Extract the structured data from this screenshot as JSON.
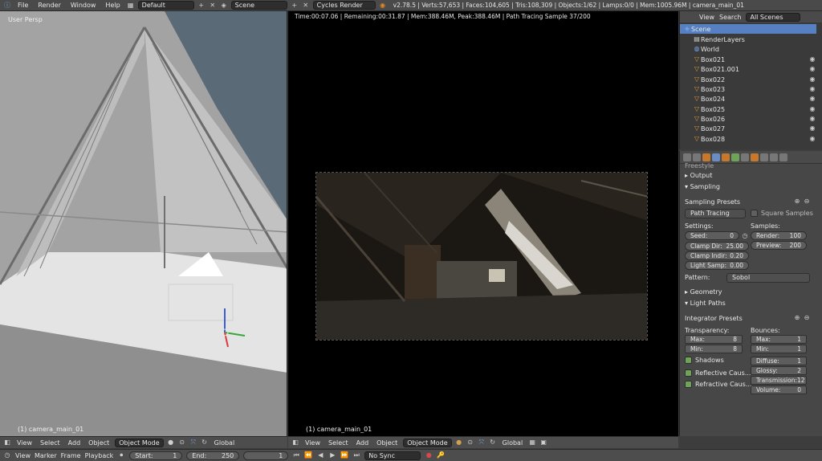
{
  "topbar": {
    "menus": [
      "File",
      "Render",
      "Window",
      "Help"
    ],
    "layout": "Default",
    "scene": "Scene",
    "engine": "Cycles Render",
    "stats": "v2.78.5 | Verts:57,653 | Faces:104,605 | Tris:108,309 | Objects:1/62 | Lamps:0/0 | Mem:1005.96M | camera_main_01"
  },
  "left_view": {
    "label": "User Persp",
    "object_label": "(1) camera_main_01",
    "header": {
      "view": "View",
      "select": "Select",
      "add": "Add",
      "object": "Object",
      "mode": "Object Mode",
      "orient": "Global"
    }
  },
  "render_view": {
    "status": "Time:00:07.06 | Remaining:00:31.87 | Mem:388.46M, Peak:388.46M | Path Tracing Sample 37/200",
    "object_label": "(1) camera_main_01",
    "header": {
      "view": "View",
      "select": "Select",
      "add": "Add",
      "object": "Object",
      "mode": "Object Mode",
      "orient": "Global"
    }
  },
  "outliner": {
    "view": "View",
    "search": "Search",
    "filter": "All Scenes",
    "items": [
      "Scene",
      "RenderLayers",
      "World",
      "Box021",
      "Box021.001",
      "Box022",
      "Box023",
      "Box024",
      "Box025",
      "Box026",
      "Box027",
      "Box028"
    ]
  },
  "props": {
    "partial_panel": "Freestyle",
    "output": "Output",
    "sampling": "Sampling",
    "sampling_presets": "Sampling Presets",
    "integrator": "Path Tracing",
    "square_samples": "Square Samples",
    "settings": "Settings:",
    "samples": "Samples:",
    "seed": {
      "label": "Seed:",
      "value": "0"
    },
    "clamp_direct": {
      "label": "Clamp Dir:",
      "value": "25.00"
    },
    "clamp_indirect": {
      "label": "Clamp Indir:",
      "value": "0.20"
    },
    "light_sample": {
      "label": "Light Samp:",
      "value": "0.00"
    },
    "render_samples": {
      "label": "Render:",
      "value": "100"
    },
    "preview_samples": {
      "label": "Preview:",
      "value": "200"
    },
    "pattern": {
      "label": "Pattern:",
      "value": "Sobol"
    },
    "geometry": "Geometry",
    "light_paths": "Light Paths",
    "integrator_presets": "Integrator Presets",
    "transparency": "Transparency:",
    "bounces": "Bounces:",
    "t_max": {
      "label": "Max:",
      "value": "8"
    },
    "t_min": {
      "label": "Min:",
      "value": "8"
    },
    "b_max": {
      "label": "Max:",
      "value": "1"
    },
    "b_min": {
      "label": "Min:",
      "value": "1"
    },
    "shadows": "Shadows",
    "reflective_caustics": "Reflective Caus...",
    "refractive_caustics": "Refractive Caus...",
    "diffuse": {
      "label": "Diffuse:",
      "value": "1"
    },
    "glossy": {
      "label": "Glossy:",
      "value": "2"
    },
    "transmission": {
      "label": "Transmission:",
      "value": "12"
    },
    "volume": {
      "label": "Volume:",
      "value": "0"
    }
  },
  "timeline": {
    "view": "View",
    "marker": "Marker",
    "frame": "Frame",
    "playback": "Playback",
    "start": {
      "label": "Start:",
      "value": "1"
    },
    "end": {
      "label": "End:",
      "value": "250"
    },
    "current": "1",
    "sync": "No Sync"
  }
}
